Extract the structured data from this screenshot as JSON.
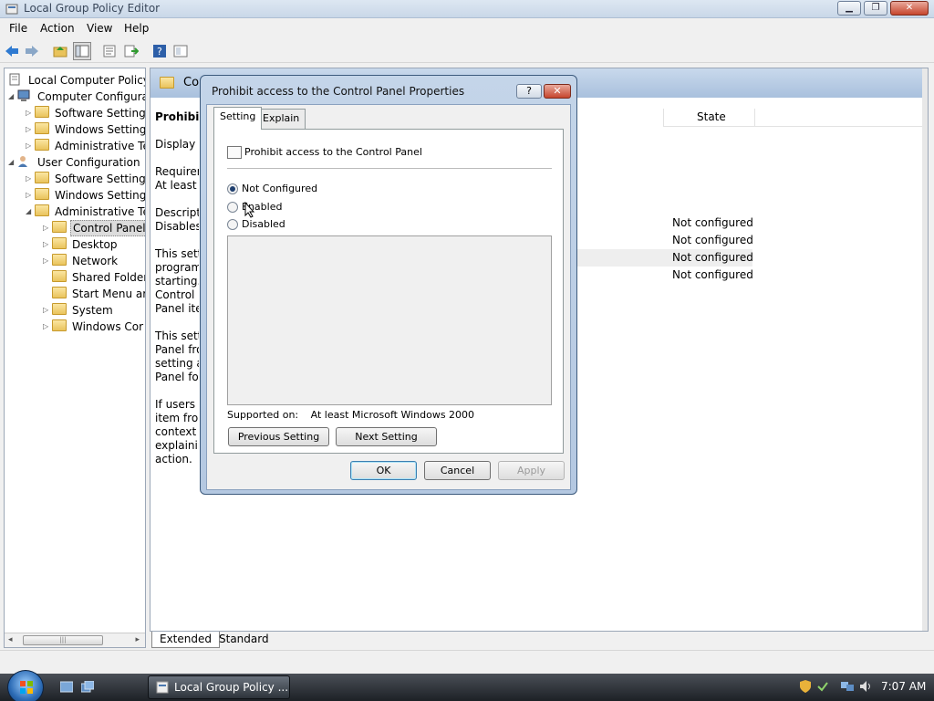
{
  "window": {
    "title": "Local Group Policy Editor",
    "buttons": {
      "minimize": "▁",
      "restore": "❐",
      "close": "✕"
    }
  },
  "menu": [
    "File",
    "Action",
    "View",
    "Help"
  ],
  "tree": {
    "root": "Local Computer Policy",
    "items": [
      {
        "label": "Computer Configura",
        "level": 1,
        "expander": "◢"
      },
      {
        "label": "Software Settings",
        "level": 2,
        "expander": "▷"
      },
      {
        "label": "Windows Setting",
        "level": 2,
        "expander": "▷"
      },
      {
        "label": "Administrative Te",
        "level": 2,
        "expander": "▷"
      },
      {
        "label": "User Configuration",
        "level": 1,
        "expander": "◢"
      },
      {
        "label": "Software Settings",
        "level": 2,
        "expander": "▷"
      },
      {
        "label": "Windows Setting",
        "level": 2,
        "expander": "▷"
      },
      {
        "label": "Administrative Te",
        "level": 2,
        "expander": "◢"
      },
      {
        "label": "Control Panel",
        "level": 3,
        "expander": "▷",
        "selected": true
      },
      {
        "label": "Desktop",
        "level": 3,
        "expander": "▷"
      },
      {
        "label": "Network",
        "level": 3,
        "expander": "▷"
      },
      {
        "label": "Shared Folder",
        "level": 3,
        "expander": ""
      },
      {
        "label": "Start Menu ar",
        "level": 3,
        "expander": ""
      },
      {
        "label": "System",
        "level": 3,
        "expander": "▷"
      },
      {
        "label": "Windows Cor",
        "level": 3,
        "expander": "▷"
      }
    ]
  },
  "right": {
    "header_title": "Con",
    "desc_lines": [
      "Prohibit a",
      "",
      "Display P",
      "",
      "Requirem",
      "At least M",
      "",
      "Descriptio",
      "Disables a",
      "",
      "This setti",
      "program",
      "starting. A",
      "Control P",
      "Panel iter",
      "",
      "This setti",
      "Panel fron",
      "setting al",
      "Panel fold",
      "",
      "If users tr",
      "item fron",
      "context m",
      "explainin",
      "action."
    ],
    "column_state": "State",
    "states": [
      "Not configured",
      "Not configured",
      "Not configured",
      "Not configured"
    ],
    "tabs": [
      "Extended",
      "Standard"
    ]
  },
  "dialog": {
    "title": "Prohibit access to the Control Panel Properties",
    "help_label": "?",
    "close_label": "✕",
    "tabs": [
      "Setting",
      "Explain"
    ],
    "policy_name": "Prohibit access to the Control Panel",
    "options": [
      "Not Configured",
      "Enabled",
      "Disabled"
    ],
    "selected_option": "Not Configured",
    "supported_label": "Supported on:",
    "supported_value": "At least Microsoft Windows 2000",
    "prev_button": "Previous Setting",
    "next_button": "Next Setting",
    "ok": "OK",
    "cancel": "Cancel",
    "apply": "Apply"
  },
  "taskbar": {
    "task_label": "Local Group Policy ...",
    "clock": "7:07 AM"
  },
  "colors": {
    "accent": "#a9c0dd",
    "dialog_frame": "#b4c8e1",
    "taskbar": "#1d2126"
  }
}
